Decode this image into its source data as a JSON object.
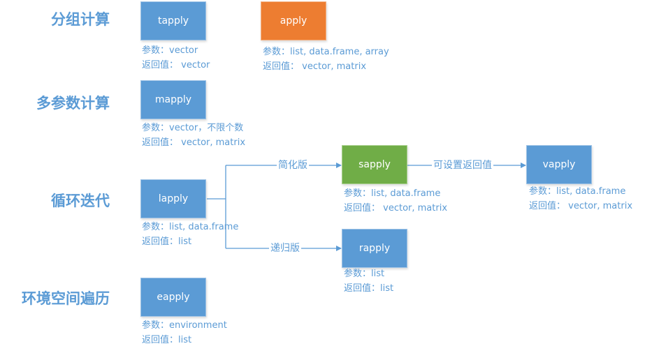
{
  "colors": {
    "primary": "#5b9bd5",
    "orange": "#ed7d31",
    "green": "#70ad47",
    "text": "#5b9bd5"
  },
  "categories": {
    "group": "分组计算",
    "multi": "多参数计算",
    "loop": "循环迭代",
    "env": "环境空间遍历"
  },
  "param_prefix": "参数：",
  "return_prefix": "返回值：",
  "nodes": {
    "tapply": {
      "label": "tapply",
      "params": "参数：vector",
      "returns": "返回值： vector"
    },
    "apply": {
      "label": "apply",
      "params": "参数：list, data.frame, array",
      "returns": "返回值： vector, matrix"
    },
    "mapply": {
      "label": "mapply",
      "params": "参数：vector，不限个数",
      "returns": "返回值： vector, matrix"
    },
    "lapply": {
      "label": "lapply",
      "params": "参数：list, data.frame",
      "returns": "返回值：list"
    },
    "sapply": {
      "label": "sapply",
      "params": "参数：list, data.frame",
      "returns": "返回值： vector, matrix"
    },
    "vapply": {
      "label": "vapply",
      "params": "参数：list, data.frame",
      "returns": "返回值： vector, matrix"
    },
    "rapply": {
      "label": "rapply",
      "params": "参数：list",
      "returns": "返回值：list"
    },
    "eapply": {
      "label": "eapply",
      "params": "参数：environment",
      "returns": "返回值：list"
    }
  },
  "edges": {
    "lapply_sapply": "简化版",
    "lapply_rapply": "递归版",
    "sapply_vapply": "可设置返回值"
  }
}
